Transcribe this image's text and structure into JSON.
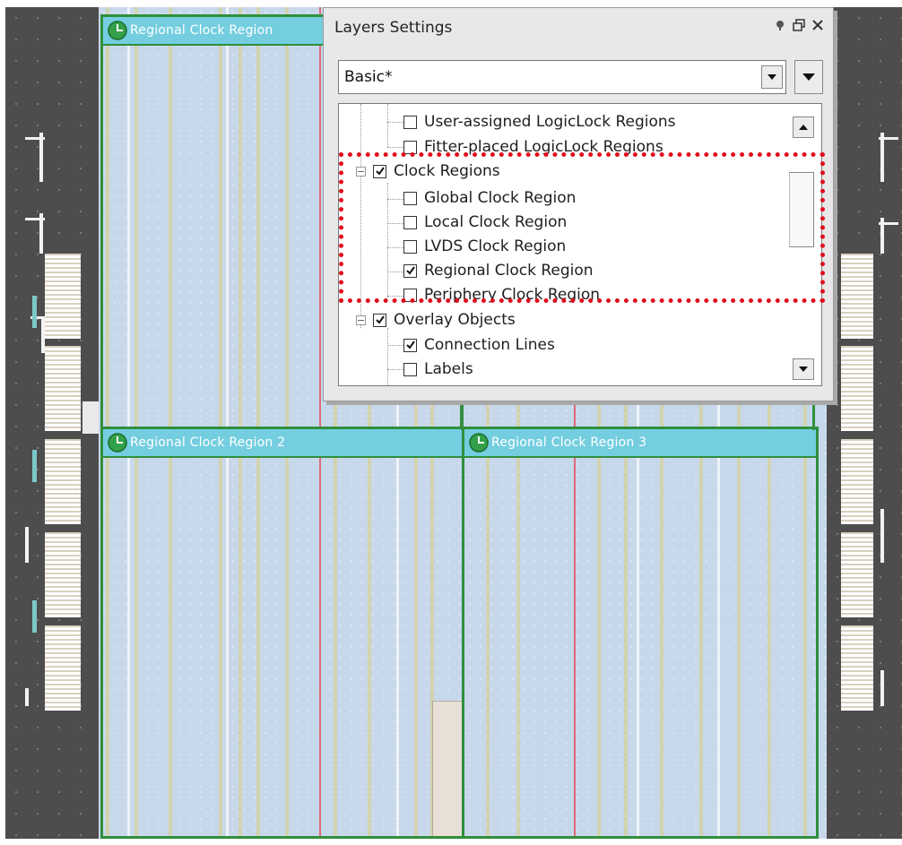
{
  "regions": {
    "top_left_label": "Regional Clock Region",
    "bottom_left_label": "Regional Clock Region 2",
    "bottom_right_label": "Regional Clock Region 3"
  },
  "panel": {
    "title": "Layers Settings",
    "preset_select": {
      "value": "Basic*"
    },
    "tree": [
      {
        "label": "User-assigned LogicLock Regions",
        "checked": false,
        "level": 1
      },
      {
        "label": "Fitter-placed LogicLock Regions",
        "checked": false,
        "level": 1
      },
      {
        "label": "Clock Regions",
        "checked": true,
        "level": 0,
        "expanded": true
      },
      {
        "label": "Global Clock Region",
        "checked": false,
        "level": 1
      },
      {
        "label": "Local Clock Region",
        "checked": false,
        "level": 1
      },
      {
        "label": "LVDS Clock Region",
        "checked": false,
        "level": 1
      },
      {
        "label": "Regional Clock Region",
        "checked": true,
        "level": 1
      },
      {
        "label": "Periphery Clock Region",
        "checked": false,
        "level": 1
      },
      {
        "label": "Overlay Objects",
        "checked": true,
        "level": 0,
        "expanded": true
      },
      {
        "label": "Connection Lines",
        "checked": true,
        "level": 1
      },
      {
        "label": "Labels",
        "checked": false,
        "level": 1
      }
    ]
  },
  "colors": {
    "region_border": "#2f8f3c",
    "region_header": "#74cee0",
    "highlight": "#e10c1c",
    "core": "#c8d8eb"
  }
}
